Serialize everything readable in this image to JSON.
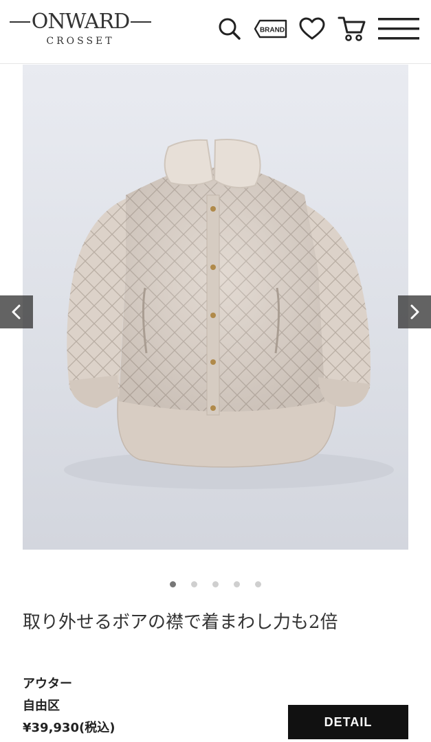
{
  "header": {
    "logo_main": "ONWARD",
    "logo_sub": "CROSSET",
    "brand_icon_label": "BRAND",
    "icons": [
      "search-icon",
      "brand-icon",
      "heart-icon",
      "cart-icon",
      "menu-icon"
    ]
  },
  "carousel": {
    "image_alt_name": "quilted-jacket-image",
    "slide_count": 5,
    "active_index": 0
  },
  "product": {
    "headline": "取り外せるボアの襟で着まわし力も2倍",
    "category": "アウター",
    "brand": "自由区",
    "price": "¥39,930(税込)",
    "detail_label": "DETAIL"
  },
  "colors": {
    "accent": "#111111",
    "jacket": "#d9cfc6"
  }
}
